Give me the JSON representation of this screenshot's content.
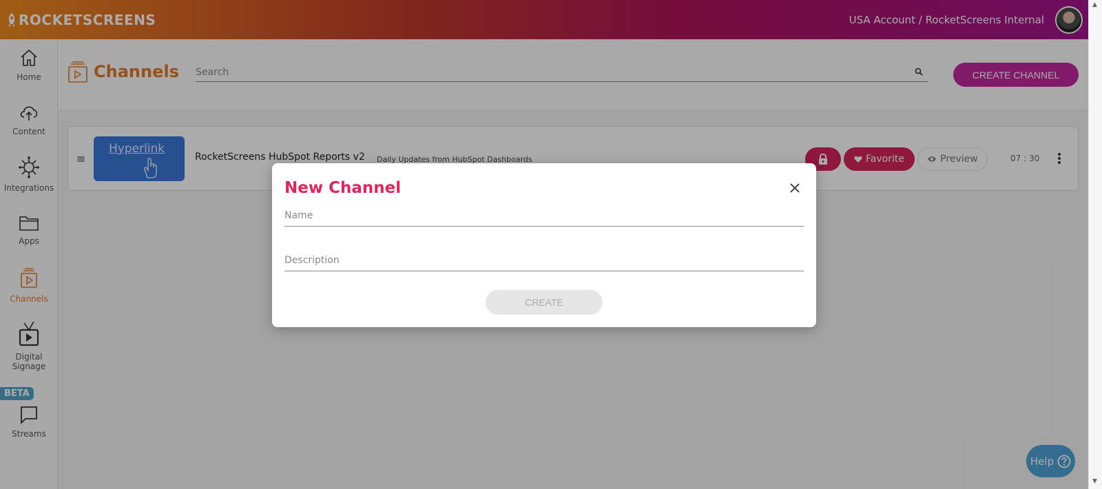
{
  "header": {
    "brand": "ROCKETSCREENS",
    "account": "USA Account / RocketScreens Internal"
  },
  "sidebar": {
    "items": [
      {
        "label": "Home",
        "icon": "home-icon"
      },
      {
        "label": "Content",
        "icon": "cloud-upload-icon"
      },
      {
        "label": "Integrations",
        "icon": "integrations-icon"
      },
      {
        "label": "Apps",
        "icon": "folder-icon"
      },
      {
        "label": "Channels",
        "icon": "channels-icon",
        "active": true
      },
      {
        "label": "Digital Signage",
        "icon": "tv-icon"
      },
      {
        "label": "Streams",
        "icon": "chat-icon"
      }
    ],
    "beta_badge": "BETA"
  },
  "page": {
    "title": "Channels",
    "search_placeholder": "Search",
    "create_label": "CREATE CHANNEL"
  },
  "channels": [
    {
      "thumb_text": "Hyperlink",
      "name": "RocketScreens HubSpot Reports v2",
      "description": "Daily Updates from HubSpot Dashboards",
      "favorite_label": "Favorite",
      "preview_label": "Preview",
      "duration": "07 : 30"
    }
  ],
  "modal": {
    "title": "New Channel",
    "name_placeholder": "Name",
    "description_placeholder": "Description",
    "create_label": "CREATE"
  },
  "help": {
    "label": "Help"
  },
  "colors": {
    "accent_orange": "#e07a2a",
    "accent_pink": "#e2245f",
    "accent_purple": "#c2279f",
    "help_blue": "#4fa3d7"
  }
}
